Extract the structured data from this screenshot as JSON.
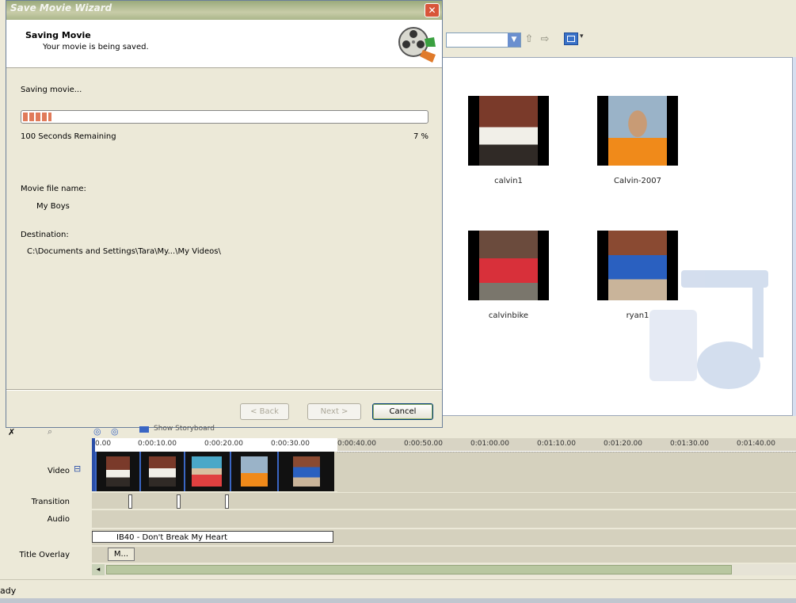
{
  "wizard": {
    "title": "Save Movie Wizard",
    "close_glyph": "✕",
    "heading": "Saving Movie",
    "subheading": "Your movie is being saved.",
    "status": "Saving movie...",
    "progress_fraction": 0.07,
    "time_remaining": "100 Seconds Remaining",
    "percent": "7 %",
    "filename_label": "Movie file name:",
    "filename": "My Boys",
    "destination_label": "Destination:",
    "destination": "C:\\Documents and Settings\\Tara\\My...\\My Videos\\",
    "buttons": {
      "back": "< Back",
      "next": "Next >",
      "cancel": "Cancel"
    }
  },
  "collection": {
    "items": [
      {
        "label": "calvin1",
        "photo_colors": [
          "#7a3a2a",
          "#f1efe8",
          "#302a26"
        ]
      },
      {
        "label": "Calvin-2007",
        "photo_colors": [
          "#9ab3c8",
          "#f08a1a",
          "#c89b75"
        ]
      },
      {
        "label": "calvinbike",
        "photo_colors": [
          "#6b4b3d",
          "#d8303a",
          "#7a766c"
        ]
      },
      {
        "label": "ryan1",
        "photo_colors": [
          "#8a4a32",
          "#2a60c0",
          "#c9b49a"
        ]
      }
    ]
  },
  "timeline": {
    "toolbar_label": "Show Storyboard",
    "ruler_ticks": [
      "0.00",
      "0:00:10.00",
      "0:00:20.00",
      "0:00:30.00",
      "0:00:40.00",
      "0:00:50.00",
      "0:01:00.00",
      "0:01:10.00",
      "0:01:20.00",
      "0:01:30.00",
      "0:01:40.00"
    ],
    "tracks": {
      "video": "Video",
      "expand": "⊟",
      "transition": "Transition",
      "audio": "Audio",
      "title_overlay": "Title Overlay"
    },
    "music_clip": "IB40 - Don't Break My Heart",
    "title_clip": "M..."
  },
  "status_bar": {
    "text": "ady"
  },
  "colors": {
    "accent": "#3a66c4",
    "progress": "#e07a5a",
    "window_bg": "#ece9d8"
  }
}
